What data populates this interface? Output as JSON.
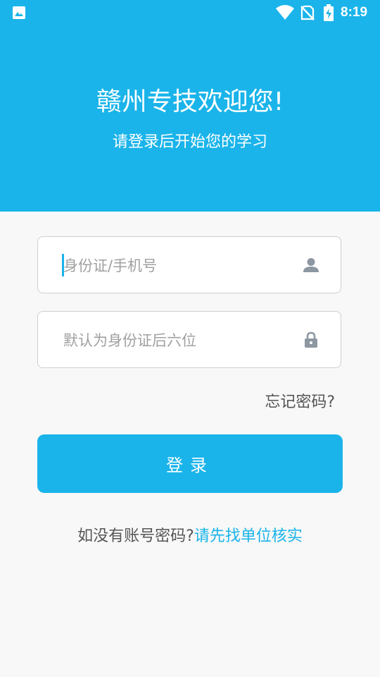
{
  "status_bar": {
    "time": "8:19",
    "icons": [
      "photo-icon",
      "wifi-icon",
      "no-sim-icon",
      "battery-charging-icon"
    ]
  },
  "header": {
    "title": "赣州专技欢迎您!",
    "subtitle": "请登录后开始您的学习",
    "background_color": "#1ab4ea"
  },
  "form": {
    "username": {
      "value": "",
      "placeholder": "身份证/手机号",
      "icon": "user-icon"
    },
    "password": {
      "value": "",
      "placeholder": "默认为身份证后六位",
      "icon": "lock-icon"
    },
    "forgot_label": "忘记密码?",
    "login_label": "登录"
  },
  "footer": {
    "question": "如没有账号密码?",
    "link_label": "请先找单位核实"
  },
  "colors": {
    "accent": "#1ab4ea",
    "background": "#f8f8f8"
  }
}
